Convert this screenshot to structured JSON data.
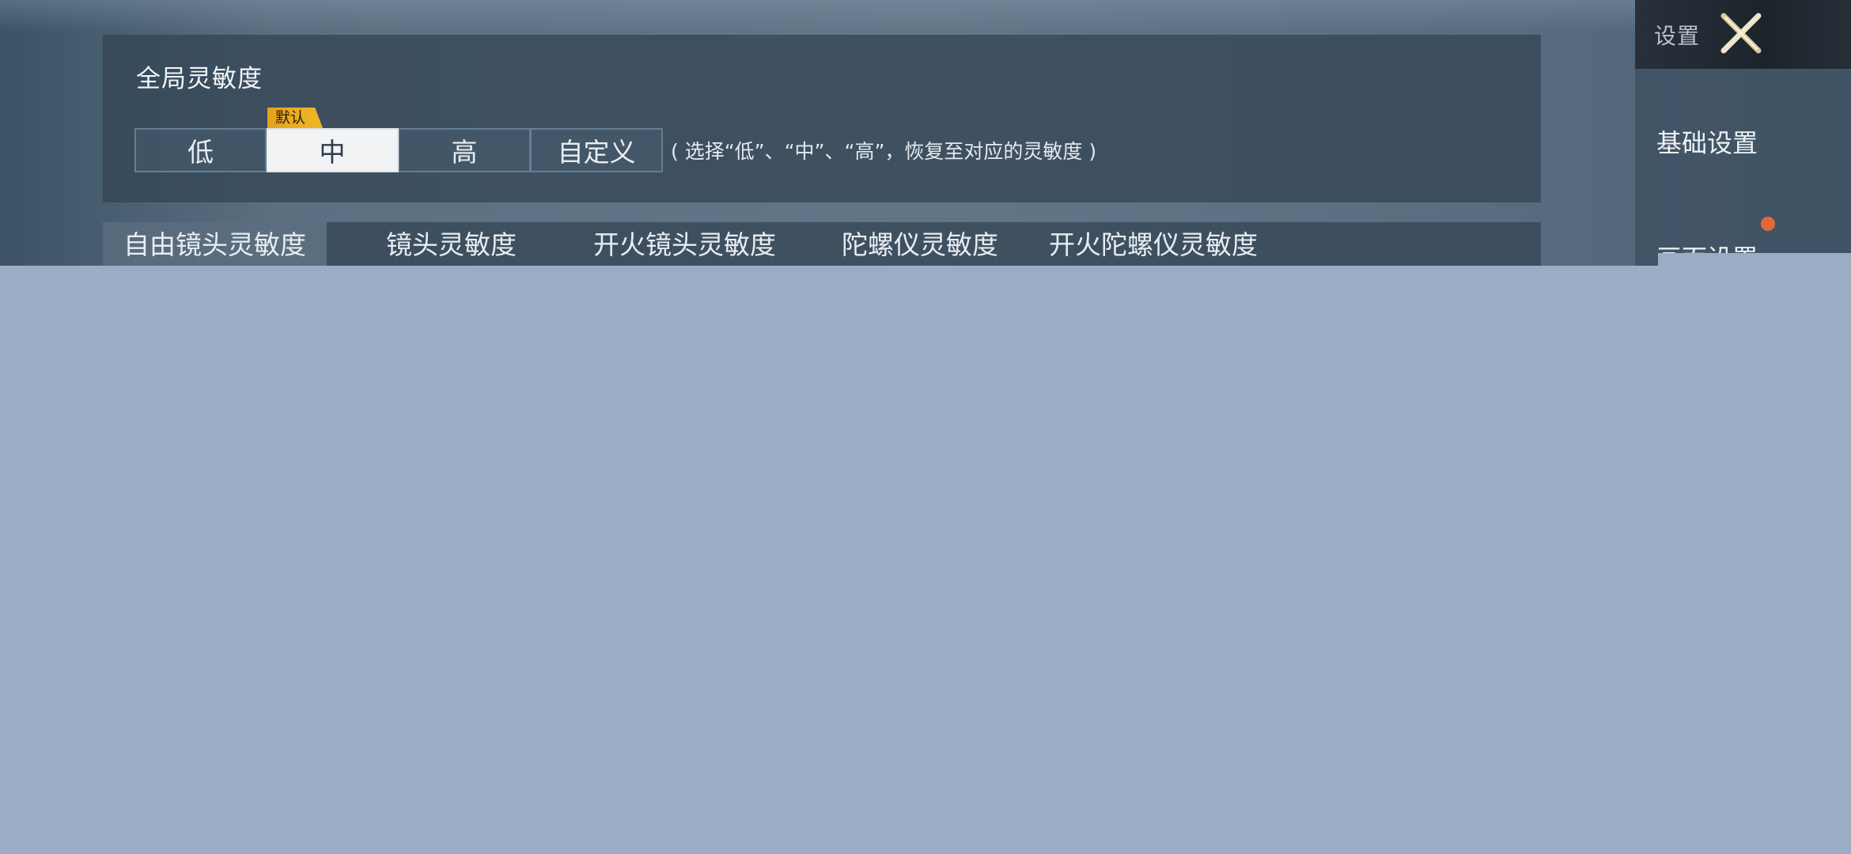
{
  "global_sensitivity": {
    "title": "全局灵敏度",
    "default_badge": "默认",
    "levels": [
      {
        "label": "低",
        "selected": false
      },
      {
        "label": "中",
        "selected": true
      },
      {
        "label": "高",
        "selected": false
      },
      {
        "label": "自定义",
        "selected": false
      }
    ],
    "hint": "( 选择“低”、“中”、“高”，恢复至对应的灵敏度 )"
  },
  "sensitivity_tabs": [
    {
      "label": "自由镜头灵敏度",
      "active": true
    },
    {
      "label": "镜头灵敏度",
      "active": false
    },
    {
      "label": "开火镜头灵敏度",
      "active": false
    },
    {
      "label": "陀螺仪灵敏度",
      "active": false
    },
    {
      "label": "开火陀螺仪灵敏度",
      "active": false
    }
  ],
  "sidebar": {
    "header_title": "设置",
    "items": [
      {
        "label": "基础设置"
      },
      {
        "label": "画面设置",
        "has_notification": true
      }
    ]
  },
  "colors": {
    "accent_gold": "#f1b62a",
    "notification": "#e2683a",
    "overlay": "#9aadc4"
  },
  "icons": {
    "close": "close-x-icon"
  }
}
